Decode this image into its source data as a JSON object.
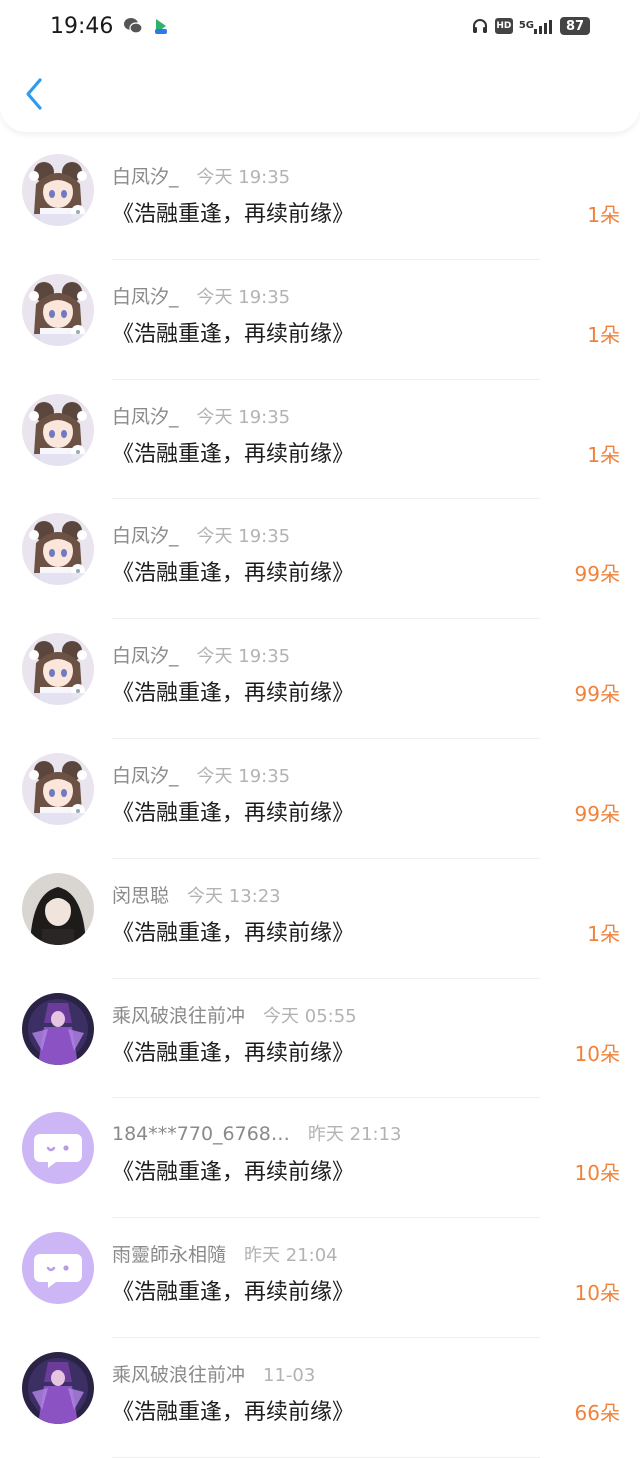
{
  "status_bar": {
    "time": "19:46",
    "icons": [
      "wechat-icon",
      "video-app-icon",
      "headphones-icon",
      "hd-icon",
      "signal-5g-icon"
    ],
    "hd": "HD",
    "network": "5G",
    "battery": "87"
  },
  "nav": {
    "back_icon": "chevron-left-icon"
  },
  "rows": [
    {
      "name": "白凤汐_",
      "time": "今天 19:35",
      "title": "《浩融重逢，再续前缘》",
      "count": "1朵",
      "avatar": "anime-girl"
    },
    {
      "name": "白凤汐_",
      "time": "今天 19:35",
      "title": "《浩融重逢，再续前缘》",
      "count": "1朵",
      "avatar": "anime-girl"
    },
    {
      "name": "白凤汐_",
      "time": "今天 19:35",
      "title": "《浩融重逢，再续前缘》",
      "count": "1朵",
      "avatar": "anime-girl"
    },
    {
      "name": "白凤汐_",
      "time": "今天 19:35",
      "title": "《浩融重逢，再续前缘》",
      "count": "99朵",
      "avatar": "anime-girl"
    },
    {
      "name": "白凤汐_",
      "time": "今天 19:35",
      "title": "《浩融重逢，再续前缘》",
      "count": "99朵",
      "avatar": "anime-girl"
    },
    {
      "name": "白凤汐_",
      "time": "今天 19:35",
      "title": "《浩融重逢，再续前缘》",
      "count": "99朵",
      "avatar": "anime-girl"
    },
    {
      "name": "闵思聪",
      "time": "今天 13:23",
      "title": "《浩融重逢，再续前缘》",
      "count": "1朵",
      "avatar": "dark-portrait"
    },
    {
      "name": "乘风破浪往前冲",
      "time": "今天 05:55",
      "title": "《浩融重逢，再续前缘》",
      "count": "10朵",
      "avatar": "purple-warrior"
    },
    {
      "name": "184***770_6768…",
      "time": "昨天 21:13",
      "title": "《浩融重逢，再续前缘》",
      "count": "10朵",
      "avatar": "chat-bubble"
    },
    {
      "name": "雨靈師永相隨",
      "time": "昨天 21:04",
      "title": "《浩融重逢，再续前缘》",
      "count": "10朵",
      "avatar": "chat-bubble"
    },
    {
      "name": "乘风破浪往前冲",
      "time": "11-03",
      "title": "《浩融重逢，再续前缘》",
      "count": "66朵",
      "avatar": "purple-warrior"
    }
  ],
  "colors": {
    "count": "#f0823a",
    "name": "#8a8a8a",
    "time": "#b3b3b3",
    "title": "#1d1d1d",
    "back": "#2e9bf0",
    "chat_bubble_bg": "#cdb6f5"
  }
}
